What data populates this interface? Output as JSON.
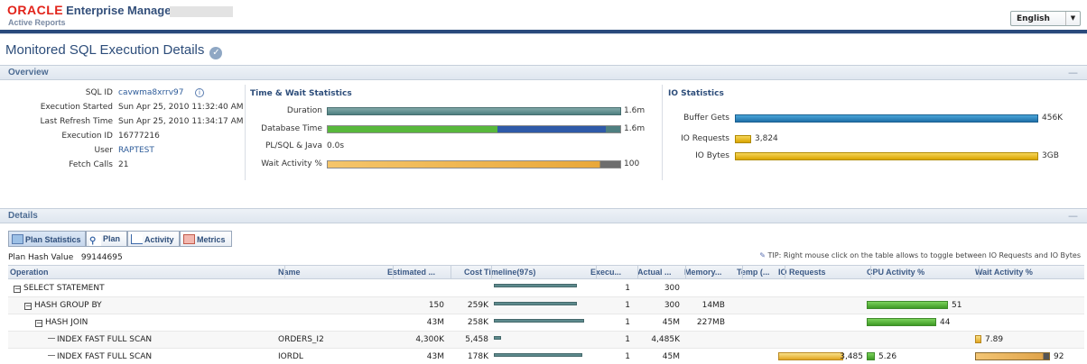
{
  "header": {
    "brand": "ORACLE",
    "product": "Enterprise Manager",
    "subtitle": "Active Reports",
    "language": "English"
  },
  "page": {
    "title": "Monitored SQL Execution Details"
  },
  "overview": {
    "title": "Overview",
    "fields": [
      {
        "label": "SQL ID",
        "value": "cavwma8xrrv97"
      },
      {
        "label": "Execution Started",
        "value": "Sun Apr 25, 2010 11:32:40 AM"
      },
      {
        "label": "Last Refresh Time",
        "value": "Sun Apr 25, 2010 11:34:17 AM"
      },
      {
        "label": "Execution ID",
        "value": "16777216"
      },
      {
        "label": "User",
        "value": "RAPTEST"
      },
      {
        "label": "Fetch Calls",
        "value": "21"
      }
    ],
    "time_wait": {
      "title": "Time & Wait Statistics",
      "rows": [
        {
          "label": "Duration",
          "value": "1.6m",
          "fill": 1.0
        },
        {
          "label": "Database Time",
          "value": "1.6m",
          "fill": 1.0
        },
        {
          "label": "PL/SQL & Java",
          "value": "0.0s",
          "fill": 0
        },
        {
          "label": "Wait Activity %",
          "value": "100",
          "fill": 1.0
        }
      ]
    },
    "io": {
      "title": "IO Statistics",
      "rows": [
        {
          "label": "Buffer Gets",
          "value": "456K",
          "fill": 1.0
        },
        {
          "label": "IO Requests",
          "value": "3,824",
          "fill": 0.05
        },
        {
          "label": "IO Bytes",
          "value": "3GB",
          "fill": 1.0
        }
      ]
    }
  },
  "details": {
    "title": "Details",
    "tabs": [
      "Plan Statistics",
      "Plan",
      "Activity",
      "Metrics"
    ],
    "plan_hash_label": "Plan Hash Value",
    "plan_hash_value": "99144695",
    "tip": "TIP: Right mouse click on the table allows to toggle between IO Requests and IO Bytes",
    "columns": [
      "Operation",
      "Name",
      "Estimated ...",
      "Cost",
      "Timeline(97s)",
      "Execu...",
      "Actual ...",
      "Memory...",
      "Temp (...",
      "IO Requests",
      "CPU Activity %",
      "Wait Activity %"
    ],
    "rows": [
      {
        "operation": "SELECT STATEMENT",
        "toggle": "−",
        "indent": 0,
        "name": "",
        "estimated": "",
        "cost": "",
        "execs": "1",
        "actual": "300",
        "memory": "",
        "temp": "",
        "io": "",
        "cpu": "",
        "wait": "",
        "tl_start": 0.0,
        "tl_len": 0.92
      },
      {
        "operation": "HASH GROUP BY",
        "toggle": "−",
        "indent": 1,
        "name": "",
        "estimated": "150",
        "cost": "259K",
        "execs": "1",
        "actual": "300",
        "memory": "14MB",
        "temp": "",
        "io": "",
        "cpu": "51",
        "wait": "",
        "tl_start": 0.0,
        "tl_len": 0.92,
        "cpu_fill": 0.51
      },
      {
        "operation": "HASH JOIN",
        "toggle": "−",
        "indent": 2,
        "name": "",
        "estimated": "43M",
        "cost": "258K",
        "execs": "1",
        "actual": "45M",
        "memory": "227MB",
        "temp": "",
        "io": "",
        "cpu": "44",
        "wait": "",
        "tl_start": 0.0,
        "tl_len": 1.0,
        "cpu_fill": 0.44
      },
      {
        "operation": "INDEX FAST FULL SCAN",
        "toggle": "",
        "indent": 3,
        "name": "ORDERS_I2",
        "estimated": "4,300K",
        "cost": "5,458",
        "execs": "1",
        "actual": "4,485K",
        "memory": "",
        "temp": "",
        "io": "",
        "cpu": "",
        "wait": "7.89",
        "tl_start": 0.0,
        "tl_len": 0.08,
        "wait_fill": 0.08
      },
      {
        "operation": "INDEX FAST FULL SCAN",
        "toggle": "",
        "indent": 3,
        "name": "IORDL",
        "estimated": "43M",
        "cost": "178K",
        "execs": "1",
        "actual": "45M",
        "memory": "",
        "temp": "",
        "io": "3,485",
        "cpu": "5.26",
        "wait": "92",
        "tl_start": 0.0,
        "tl_len": 0.98,
        "io_fill": 0.9,
        "cpu_fill": 0.05,
        "wait_fill": 0.92
      }
    ]
  }
}
